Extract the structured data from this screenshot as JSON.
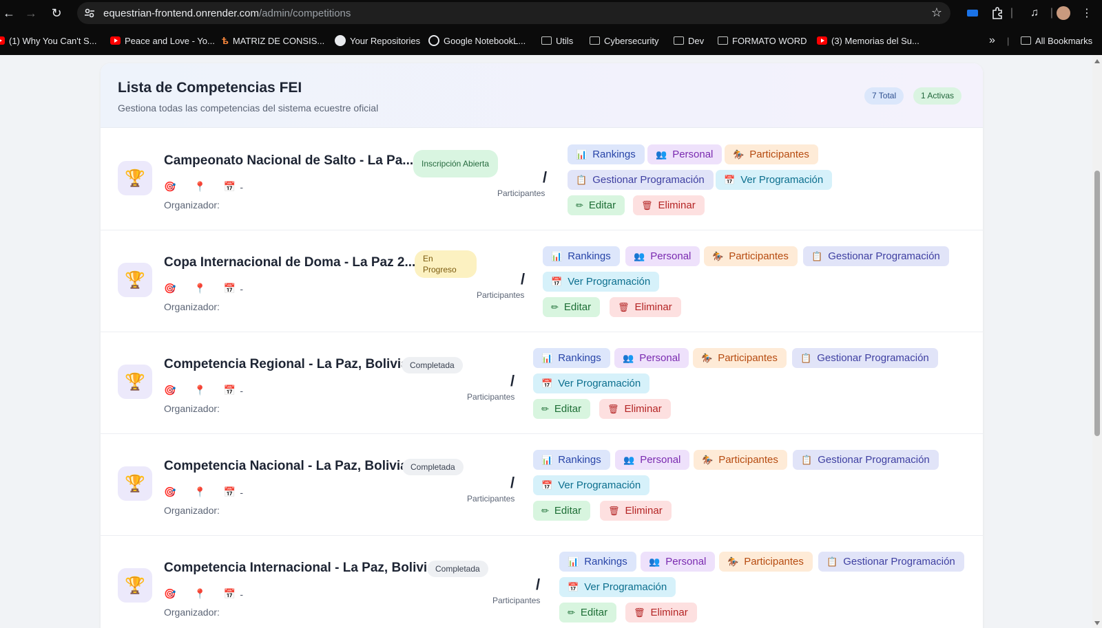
{
  "browser": {
    "url_domain": "equestrian-frontend.onrender.com",
    "url_path": "/admin/competitions",
    "bookmarks": [
      {
        "label": "(1) Why You Can't S...",
        "icon": "youtube-icon"
      },
      {
        "label": "Peace and Love - Yo...",
        "icon": "youtube-icon"
      },
      {
        "label": "MATRIZ DE CONSIS...",
        "icon": "matriz-icon"
      },
      {
        "label": "Your Repositories",
        "icon": "github-icon"
      },
      {
        "label": "Google NotebookL...",
        "icon": "notebooklm-icon"
      },
      {
        "label": "Utils",
        "icon": "folder-icon"
      },
      {
        "label": "Cybersecurity",
        "icon": "folder-icon"
      },
      {
        "label": "Dev",
        "icon": "folder-icon"
      },
      {
        "label": "FORMATO WORD",
        "icon": "folder-icon"
      },
      {
        "label": "(3) Memorias del Su...",
        "icon": "youtube-icon"
      }
    ],
    "more_bookmarks": "»",
    "all_bookmarks": "All Bookmarks"
  },
  "header": {
    "title": "Lista de Competencias FEI",
    "subtitle": "Gestiona todas las competencias del sistema ecuestre oficial",
    "total": "7 Total",
    "active": "1 Activas"
  },
  "labels": {
    "organizer": "Organizador:",
    "participants": "Participantes",
    "slash": "/",
    "date_dash": "-",
    "rankings": "Rankings",
    "personal": "Personal",
    "participantes_btn": "Participantes",
    "gestionar": "Gestionar Programación",
    "ver": "Ver Programación",
    "editar": "Editar",
    "eliminar": "Eliminar"
  },
  "competitions": [
    {
      "name": "Campeonato Nacional de Salto - La Pa...",
      "status": "Inscripción Abierta"
    },
    {
      "name": "Copa Internacional de Doma - La Paz 2...",
      "status": "En Progreso"
    },
    {
      "name": "Competencia Regional - La Paz, Bolivia",
      "status": "Completada"
    },
    {
      "name": "Competencia Nacional - La Paz, Bolivia",
      "status": "Completada"
    },
    {
      "name": "Competencia Internacional - La Paz, Bolivia",
      "status": "Completada"
    }
  ],
  "colors": {
    "rankings": "#dde6fb",
    "personal": "#eee1fb",
    "participantes": "#feebd7",
    "gestionar": "#e1e4f8",
    "ver": "#d6f1fa",
    "editar": "#d8f5df",
    "eliminar": "#fde0e0"
  }
}
